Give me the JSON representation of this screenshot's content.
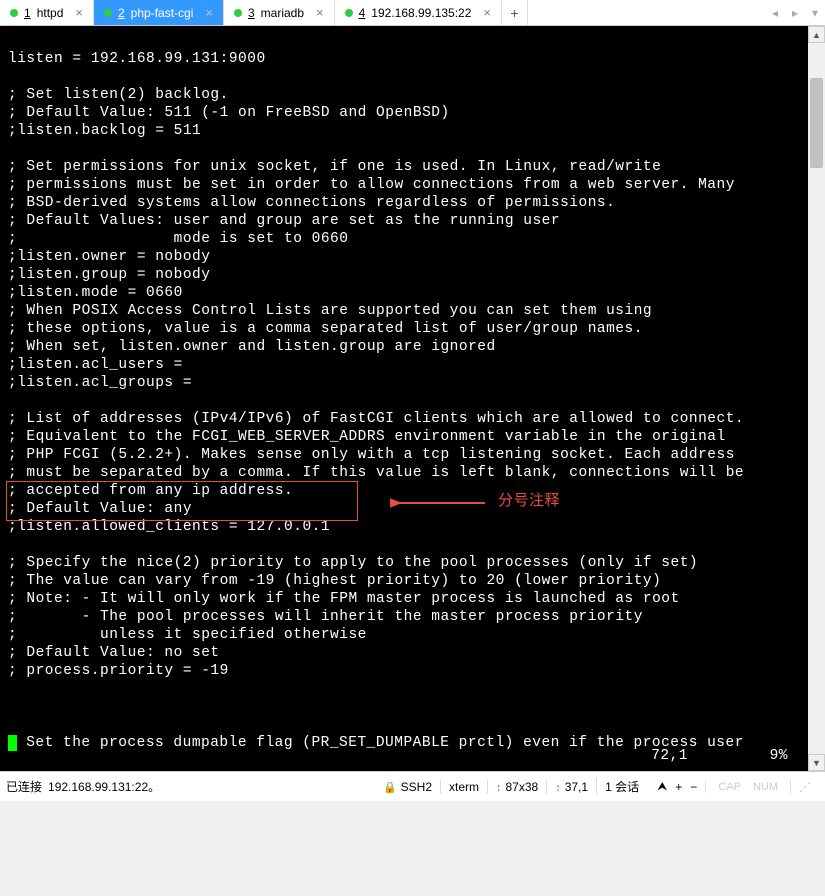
{
  "tabs": [
    {
      "num": "1",
      "label": "httpd",
      "active": false
    },
    {
      "num": "2",
      "label": "php-fast-cgi",
      "active": true
    },
    {
      "num": "3",
      "label": "mariadb",
      "active": false
    },
    {
      "num": "4",
      "label": "192.168.99.135:22",
      "active": false
    }
  ],
  "terminal": {
    "lines": [
      "listen = 192.168.99.131:9000",
      "",
      "; Set listen(2) backlog.",
      "; Default Value: 511 (-1 on FreeBSD and OpenBSD)",
      ";listen.backlog = 511",
      "",
      "; Set permissions for unix socket, if one is used. In Linux, read/write",
      "; permissions must be set in order to allow connections from a web server. Many",
      "; BSD-derived systems allow connections regardless of permissions.",
      "; Default Values: user and group are set as the running user",
      ";                 mode is set to 0660",
      ";listen.owner = nobody",
      ";listen.group = nobody",
      ";listen.mode = 0660",
      "; When POSIX Access Control Lists are supported you can set them using",
      "; these options, value is a comma separated list of user/group names.",
      "; When set, listen.owner and listen.group are ignored",
      ";listen.acl_users =",
      ";listen.acl_groups =",
      "",
      "; List of addresses (IPv4/IPv6) of FastCGI clients which are allowed to connect.",
      "; Equivalent to the FCGI_WEB_SERVER_ADDRS environment variable in the original",
      "; PHP FCGI (5.2.2+). Makes sense only with a tcp listening socket. Each address",
      "; must be separated by a comma. If this value is left blank, connections will be",
      "; accepted from any ip address.",
      "; Default Value: any",
      ";listen.allowed_clients = 127.0.0.1",
      "",
      "; Specify the nice(2) priority to apply to the pool processes (only if set)",
      "; The value can vary from -19 (highest priority) to 20 (lower priority)",
      "; Note: - It will only work if the FPM master process is launched as root",
      ";       - The pool processes will inherit the master process priority",
      ";         unless it specified otherwise",
      "; Default Value: no set",
      "; process.priority = -19",
      "",
      "",
      ""
    ],
    "last_line_prefix": "",
    "last_line_after": " Set the process dumpable flag (PR_SET_DUMPABLE prctl) even if the process user",
    "vim_position": "72,1",
    "vim_percent": "9%"
  },
  "annotation": {
    "label": "分号注释"
  },
  "statusbar": {
    "connected": "已连接",
    "host": "192.168.99.131:22。",
    "ssh": "SSH2",
    "term": "xterm",
    "size": "87x38",
    "click": "37,1",
    "session": "1 会话",
    "cap": "CAP",
    "num": "NUM"
  }
}
